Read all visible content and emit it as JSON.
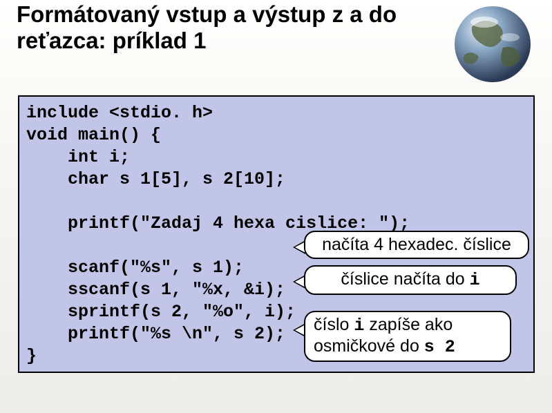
{
  "title": "Formátovaný vstup a výstup z a do reťazca: príklad 1",
  "code": {
    "l1": "include <stdio. h>",
    "l2": "void main() {",
    "l3": "    int i;",
    "l4": "    char s 1[5], s 2[10];",
    "l5": "",
    "l6": "    printf(\"Zadaj 4 hexa cislice: \");",
    "l7": "",
    "l8": "    scanf(\"%s\", s 1);",
    "l9": "    sscanf(s 1, \"%x, &i);",
    "l10": "    sprintf(s 2, \"%o\", i);",
    "l11": "    printf(\"%s \\n\", s 2);",
    "l12": "}"
  },
  "callouts": {
    "c1": "načíta 4 hexadec. číslice",
    "c2_pre": "číslice načíta do ",
    "c2_code": "i",
    "c3_pre": "číslo ",
    "c3_code1": "i",
    "c3_mid": " zapíše ako osmičkové do ",
    "c3_code2": "s 2"
  }
}
